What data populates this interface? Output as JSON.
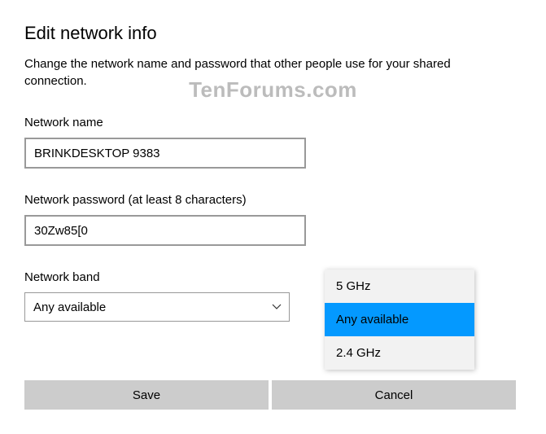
{
  "title": "Edit network info",
  "subtitle": "Change the network name and password that other people use for your shared connection.",
  "watermark": "TenForums.com",
  "fields": {
    "network_name": {
      "label": "Network name",
      "value": "BRINKDESKTOP 9383"
    },
    "network_password": {
      "label": "Network password (at least 8 characters)",
      "value": "30Zw85[0"
    },
    "network_band": {
      "label": "Network band",
      "value": "Any available",
      "options": [
        "5 GHz",
        "Any available",
        "2.4 GHz"
      ],
      "selected_index": 1
    }
  },
  "buttons": {
    "save": "Save",
    "cancel": "Cancel"
  }
}
